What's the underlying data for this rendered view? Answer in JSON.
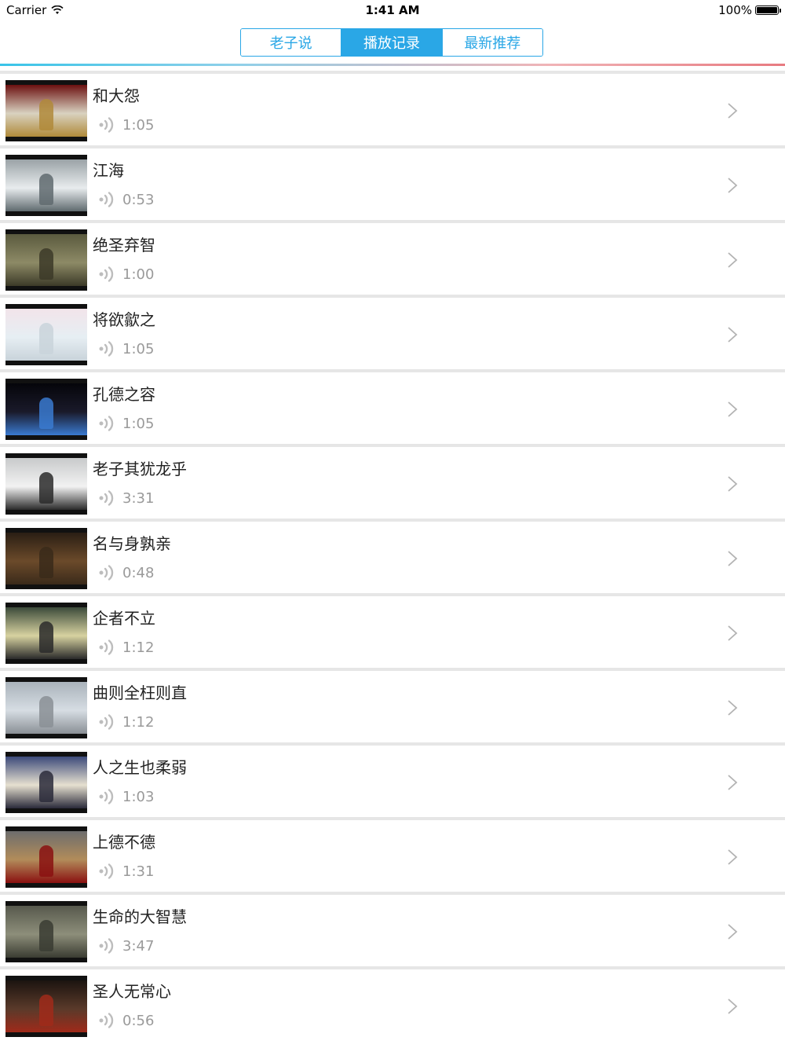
{
  "status_bar": {
    "carrier": "Carrier",
    "time": "1:41 AM",
    "battery_percent": "100%",
    "battery_level": 1.0
  },
  "tabs": [
    {
      "label": "老子说",
      "active": false
    },
    {
      "label": "播放记录",
      "active": true
    },
    {
      "label": "最新推荐",
      "active": false
    }
  ],
  "list": {
    "items": [
      {
        "title": "和大怨",
        "duration": "1:05"
      },
      {
        "title": "江海",
        "duration": "0:53"
      },
      {
        "title": "绝圣弃智",
        "duration": "1:00"
      },
      {
        "title": "将欲歙之",
        "duration": "1:05"
      },
      {
        "title": "孔德之容",
        "duration": "1:05"
      },
      {
        "title": "老子其犹龙乎",
        "duration": "3:31"
      },
      {
        "title": "名与身孰亲",
        "duration": "0:48"
      },
      {
        "title": "企者不立",
        "duration": "1:12"
      },
      {
        "title": "曲则全枉则直",
        "duration": "1:12"
      },
      {
        "title": "人之生也柔弱",
        "duration": "1:03"
      },
      {
        "title": "上德不德",
        "duration": "1:31"
      },
      {
        "title": "生命的大智慧",
        "duration": "3:47"
      },
      {
        "title": "圣人无常心",
        "duration": "0:56"
      }
    ]
  },
  "colors": {
    "accent": "#2aa7e6",
    "separator": "#e6e6e6",
    "duration_text": "#9a9a9a"
  }
}
